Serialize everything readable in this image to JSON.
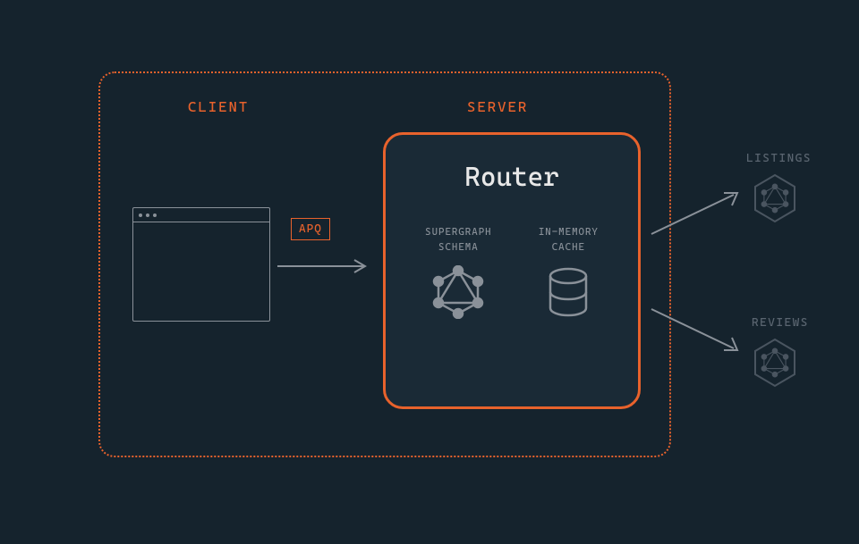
{
  "labels": {
    "client": "CLIENT",
    "server": "SERVER",
    "apq": "APQ",
    "router": "Router",
    "supergraph_line1": "SUPERGRAPH",
    "supergraph_line2": "SCHEMA",
    "cache_line1": "IN-MEMORY",
    "cache_line2": "CACHE",
    "listings": "LISTINGS",
    "reviews": "REVIEWS"
  },
  "colors": {
    "bg": "#15232d",
    "accent": "#e8622c",
    "muted": "#8a9199",
    "faded": "#5a6570",
    "white": "#e8e8e8"
  }
}
